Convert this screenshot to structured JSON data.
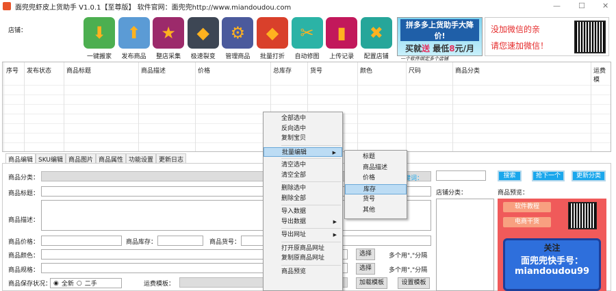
{
  "window": {
    "title": "面兜兜虾皮上货助手 V1.0.1【至尊版】 软件官网：面兜兜http://www.miandoudou.com",
    "min": "—",
    "max": "☐",
    "close": "✕"
  },
  "shop_label": "店铺：",
  "toolbar": [
    {
      "label": "一键搬家",
      "icon": "cloud-download-icon",
      "color": "#4caf50",
      "glyph": "⬇"
    },
    {
      "label": "发布商品",
      "icon": "cloud-upload-icon",
      "color": "#5b9bd5",
      "glyph": "⬆"
    },
    {
      "label": "整店采集",
      "icon": "star-icon",
      "color": "#9c2a6b",
      "glyph": "★"
    },
    {
      "label": "极速裂变",
      "icon": "layers-icon",
      "color": "#3d4654",
      "glyph": "◆"
    },
    {
      "label": "管理商品",
      "icon": "gear-icon",
      "color": "#4b5a9c",
      "glyph": "⚙"
    },
    {
      "label": "批量打折",
      "icon": "tag-icon",
      "color": "#d9402b",
      "glyph": "◆"
    },
    {
      "label": "自动修图",
      "icon": "scissors-icon",
      "color": "#2bb3a6",
      "glyph": "✂"
    },
    {
      "label": "上传记录",
      "icon": "bookmark-icon",
      "color": "#c2185b",
      "glyph": "▮"
    },
    {
      "label": "配置店铺",
      "icon": "tools-icon",
      "color": "#26a69a",
      "glyph": "✖"
    }
  ],
  "banner1": {
    "line1": "拼多多上货助手大降价!",
    "line2a": "买就",
    "line2b": "送",
    "line2c": " 最低",
    "line2d": "8",
    "line2e": "元/月",
    "line3": "一个软件绑定多个店铺"
  },
  "banner2": {
    "line1": "没加微信的亲",
    "line2": "请您速加微信！"
  },
  "table": {
    "columns": [
      "序号",
      "发布状态",
      "商品标题",
      "商品描述",
      "价格",
      "总库存",
      "货号",
      "颜色",
      "尺码",
      "商品分类",
      "运费模"
    ]
  },
  "tabs": [
    "商品编辑",
    "SKU编辑",
    "商品图片",
    "商品属性",
    "功能设置",
    "更新日志"
  ],
  "form": {
    "category": "商品分类：",
    "title": "商品标题：",
    "desc": "商品描述：",
    "price": "商品价格：",
    "stock": "商品库存：",
    "sku": "商品货号：",
    "color": "商品颜色：",
    "spec": "商品规格：",
    "condition": "商品保存状况：",
    "cond_new": "全新",
    "cond_used": "二手",
    "shipping": "运费模板：",
    "select": "选择",
    "hint": "多个用\",\"分隔",
    "load_tpl": "加载模板",
    "set_tpl": "设置模板"
  },
  "right": {
    "keyword": "关键词：",
    "search": "搜索",
    "grab_next": "抢下一个",
    "update_cat": "更新分类",
    "shop_cat": "店铺分类：",
    "preview": "商品预览：",
    "promo": {
      "tag1": "软件教程",
      "tag2": "电商干货",
      "l1": "关注",
      "l2": "面兜兜快手号：",
      "l3": "miandoudou99"
    }
  },
  "context_menu": {
    "groups": [
      [
        "全部选中",
        "反向选中",
        "复制宝贝"
      ],
      [
        "批量编辑"
      ],
      [
        "清空选中",
        "清空全部"
      ],
      [
        "删除选中",
        "删除全部"
      ],
      [
        "导入数据",
        "导出数据"
      ],
      [
        "导出网址"
      ],
      [
        "打开原商品网址",
        "复制原商品网址"
      ],
      [
        "商品预览"
      ]
    ],
    "items": {
      "select_all": "全部选中",
      "invert": "反向选中",
      "copy": "复制宝贝",
      "batch": "批量编辑",
      "clear_sel": "清空选中",
      "clear_all": "清空全部",
      "del_sel": "删除选中",
      "del_all": "删除全部",
      "import": "导入数据",
      "export": "导出数据",
      "export_url": "导出网址",
      "open_url": "打开原商品网址",
      "copy_url": "复制原商品网址",
      "preview": "商品预览"
    }
  },
  "submenu": [
    "标题",
    "商品描述",
    "价格",
    "库存",
    "货号",
    "其他"
  ]
}
